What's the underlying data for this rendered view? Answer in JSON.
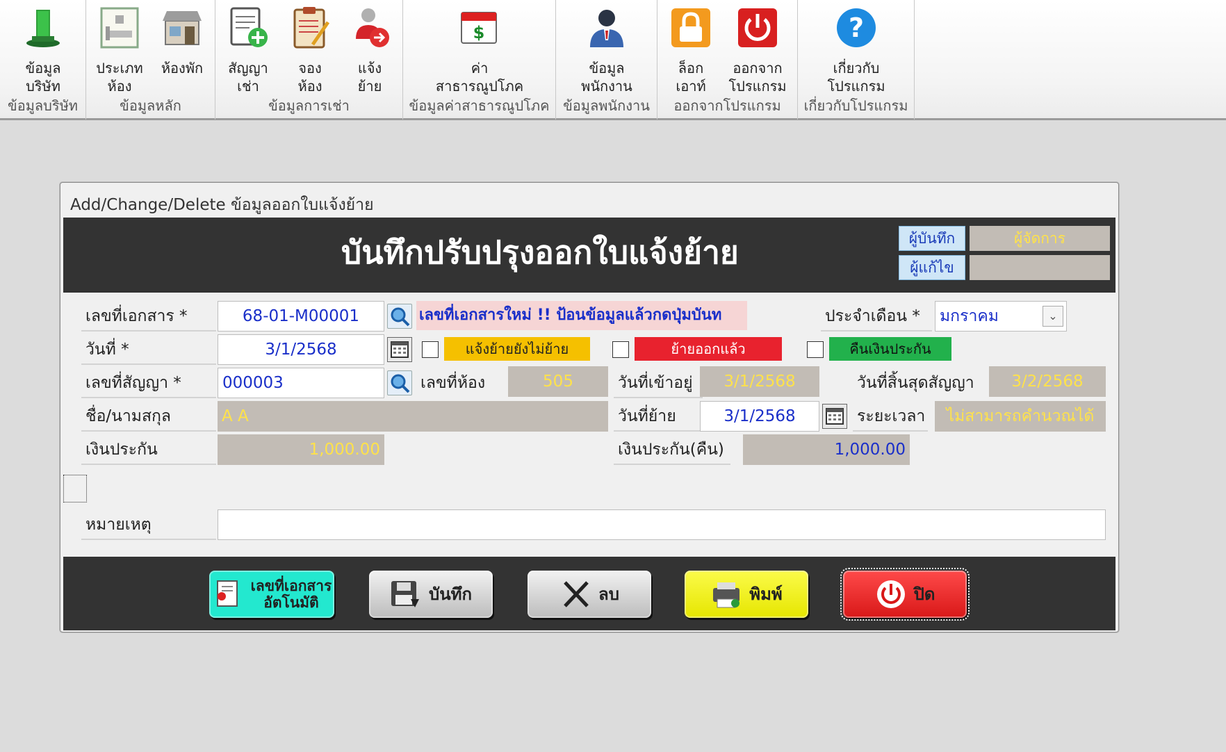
{
  "ribbon": {
    "groups": [
      {
        "label": "ข้อมูลบริษัท",
        "buttons": [
          {
            "label": "ข้อมูล\nบริษัท",
            "icon": "company-building-icon"
          }
        ]
      },
      {
        "label": "ข้อมูลหลัก",
        "buttons": [
          {
            "label": "ประเภท\nห้อง",
            "icon": "room-type-icon"
          },
          {
            "label": "ห้องพัก",
            "icon": "room-store-icon"
          }
        ]
      },
      {
        "label": "ข้อมูลการเช่า",
        "buttons": [
          {
            "label": "สัญญา\nเช่า",
            "icon": "contract-add-icon"
          },
          {
            "label": "จอง\nห้อง",
            "icon": "booking-clipboard-icon"
          },
          {
            "label": "แจ้ง\nย้าย",
            "icon": "move-notice-icon"
          }
        ]
      },
      {
        "label": "ข้อมูลค่าสาธารณูปโภค",
        "buttons": [
          {
            "label": "ค่า\nสาธารณูปโภค",
            "icon": "utility-bill-icon"
          }
        ]
      },
      {
        "label": "ข้อมูลพนักงาน",
        "buttons": [
          {
            "label": "ข้อมูล\nพนักงาน",
            "icon": "employee-icon"
          }
        ]
      },
      {
        "label": "ออกจากโปรแกรม",
        "buttons": [
          {
            "label": "ล็อก\nเอาท์",
            "icon": "lock-icon"
          },
          {
            "label": "ออกจาก\nโปรแกรม",
            "icon": "power-icon"
          }
        ]
      },
      {
        "label": "เกี่ยวกับโปรแกรม",
        "buttons": [
          {
            "label": "เกี่ยวกับ\nโปรแกรม",
            "icon": "help-icon"
          }
        ]
      }
    ]
  },
  "dialog": {
    "title": "Add/Change/Delete ข้อมูลออกใบแจ้งย้าย",
    "header": "บันทึกปรับปรุงออกใบแจ้งย้าย",
    "recorder_label": "ผู้บันทึก",
    "recorder_value": "ผู้จัดการ",
    "editor_label": "ผู้แก้ไข",
    "editor_value": ""
  },
  "form": {
    "doc_no_label": "เลขที่เอกสาร *",
    "doc_no_value": "68-01-M00001",
    "new_doc_notice": "เลขที่เอกสารใหม่ !! ป้อนข้อมูลแล้วกดปุ่มบันท",
    "month_label": "ประจำเดือน *",
    "month_value": "มกราคม",
    "date_label": "วันที่ *",
    "date_value": "3/1/2568",
    "status_not_moved": "แจ้งย้ายยังไม่ย้าย",
    "status_moved": "ย้ายออกแล้ว",
    "status_refund": "คืนเงินประกัน",
    "contract_no_label": "เลขที่สัญญา *",
    "contract_no_value": "000003",
    "room_no_label": "เลขที่ห้อง",
    "room_no_value": "505",
    "move_in_label": "วันที่เข้าอยู่",
    "move_in_value": "3/1/2568",
    "contract_end_label": "วันที่สิ้นสุดสัญญา",
    "contract_end_value": "3/2/2568",
    "name_label": "ชื่อ/นามสกุล",
    "name_value": "A A",
    "move_out_label": "วันที่ย้าย",
    "move_out_value": "3/1/2568",
    "duration_label": "ระยะเวลา",
    "duration_value": "ไม่สามารถคำนวณได้",
    "deposit_label": "เงินประกัน",
    "deposit_value": "1,000.00",
    "deposit_refund_label": "เงินประกัน(คืน)",
    "deposit_refund_value": "1,000.00",
    "remark_label": "หมายเหตุ",
    "remark_value": ""
  },
  "footer": {
    "auto_doc_label": "เลขที่เอกสาร\nอัตโนมัติ",
    "save_label": "บันทึก",
    "delete_label": "ลบ",
    "print_label": "พิมพ์",
    "close_label": "ปิด"
  },
  "colors": {
    "header_band": "#333333",
    "readonly_bg": "#c2bcb5",
    "readonly_text": "#ffe24a",
    "input_text": "#1a2fc9",
    "tag_yellow": "#f5c000",
    "tag_red": "#e8222e",
    "tag_green": "#22b14c"
  }
}
